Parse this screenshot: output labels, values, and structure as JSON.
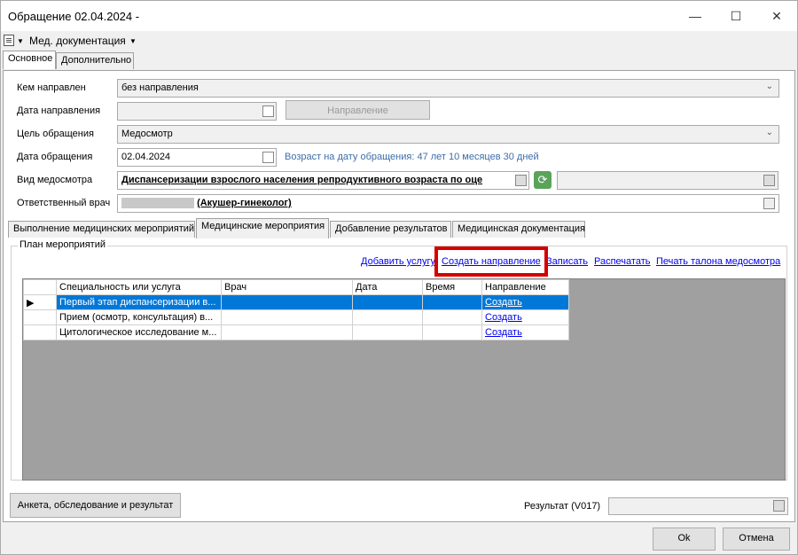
{
  "window": {
    "title": "Обращение 02.04.2024 -"
  },
  "menu": {
    "item": "Мед. документация"
  },
  "top_tabs": [
    "Основное",
    "Дополнительно"
  ],
  "form": {
    "referred_by_label": "Кем направлен",
    "referred_by_value": "без направления",
    "referral_date_label": "Дата направления",
    "referral_button": "Направление",
    "purpose_label": "Цель обращения",
    "purpose_value": "Медосмотр",
    "visit_date_label": "Дата обращения",
    "visit_date_value": "02.04.2024",
    "age_info": "Возраст на дату обращения:  47 лет 10 месяцев 30 дней",
    "exam_type_label": "Вид медосмотра",
    "exam_type_value": "Диспансеризации взрослого населения репродуктивного возраста по оце",
    "doctor_label": "Ответственный врач",
    "doctor_value": "(Акушер-гинеколог)"
  },
  "inner_tabs": [
    "Выполнение медицинских мероприятий",
    "Медицинские мероприятия",
    "Добавление результатов",
    "Медицинская документация"
  ],
  "plan": {
    "group_title": "План мероприятий",
    "links": [
      "Добавить услугу",
      "Создать направление",
      "Записать",
      "Распечатать",
      "Печать талона медосмотра"
    ]
  },
  "table": {
    "headers": [
      "Специальность или услуга",
      "Врач",
      "Дата",
      "Время",
      "Направление"
    ],
    "rows": [
      {
        "service": "Первый этап диспансеризации в...",
        "doctor": "",
        "date": "",
        "time": "",
        "referral": "Создать"
      },
      {
        "service": "Прием (осмотр, консультация) в...",
        "doctor": "",
        "date": "",
        "time": "",
        "referral": "Создать"
      },
      {
        "service": "Цитологическое исследование м...",
        "doctor": "",
        "date": "",
        "time": "",
        "referral": "Создать"
      }
    ]
  },
  "bottom": {
    "survey_button": "Анкета, обследование и результат",
    "result_label": "Результат (V017)",
    "ok": "Ok",
    "cancel": "Отмена"
  }
}
